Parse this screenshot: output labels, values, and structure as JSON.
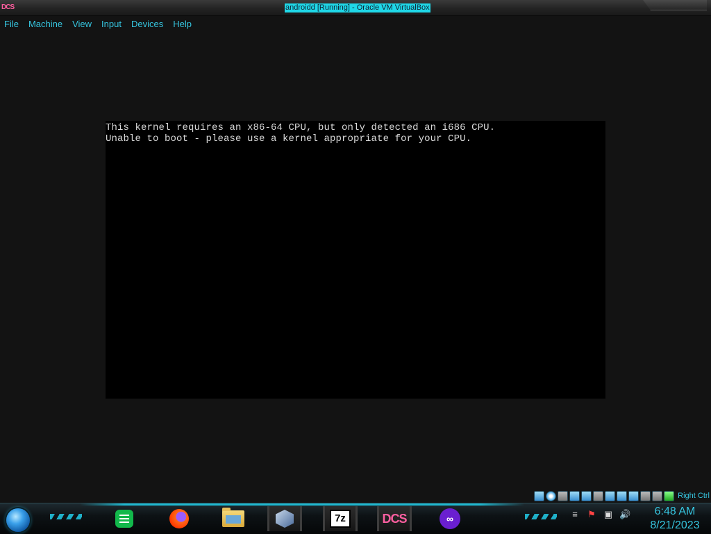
{
  "window": {
    "title": "androidd [Running] - Oracle VM VirtualBox",
    "logo_text": "DCS"
  },
  "menu": {
    "items": [
      "File",
      "Machine",
      "View",
      "Input",
      "Devices",
      "Help"
    ]
  },
  "vm": {
    "console_lines": [
      "This kernel requires an x86-64 CPU, but only detected an i686 CPU.",
      "Unable to boot - please use a kernel appropriate for your CPU."
    ]
  },
  "status_bar": {
    "host_key": "Right Ctrl",
    "icons": [
      "harddisk-icon",
      "optical-drive-icon",
      "floppy-icon",
      "audio-icon",
      "network-icon",
      "usb-icon",
      "shared-folders-icon",
      "display-icon",
      "video-capture-icon",
      "virtualization-icon",
      "mouse-integration-icon",
      "host-key-icon"
    ]
  },
  "taskbar": {
    "apps": [
      {
        "name": "sheets-app",
        "label": ""
      },
      {
        "name": "firefox-app",
        "label": ""
      },
      {
        "name": "file-explorer-app",
        "label": ""
      },
      {
        "name": "virtualbox-app",
        "label": ""
      },
      {
        "name": "7zip-app",
        "label": "7z"
      },
      {
        "name": "dcs-app",
        "label": "DCS"
      },
      {
        "name": "mask-app",
        "label": "∞"
      }
    ],
    "time": "6:48 AM",
    "date": "8/21/2023"
  },
  "colors": {
    "accent": "#36c6e0",
    "title_highlight": "#1fd8e8",
    "console_text": "#d8d8d8",
    "background": "#131313"
  }
}
